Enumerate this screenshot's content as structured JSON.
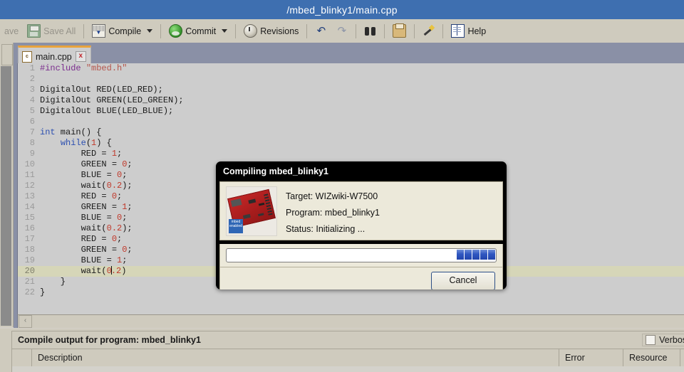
{
  "titlebar": {
    "title": "/mbed_blinky1/main.cpp"
  },
  "toolbar": {
    "items": [
      {
        "label": "ave",
        "icon": "save-icon",
        "disabled": true,
        "caret": false
      },
      {
        "label": "Save All",
        "icon": "save-all-icon",
        "disabled": true,
        "caret": false
      },
      {
        "label": "Compile",
        "icon": "compile-icon",
        "disabled": false,
        "caret": true
      },
      {
        "label": "Commit",
        "icon": "commit-icon",
        "disabled": false,
        "caret": true
      },
      {
        "label": "Revisions",
        "icon": "revisions-clock-icon",
        "disabled": false,
        "caret": false
      },
      {
        "label": "",
        "icon": "undo-icon",
        "disabled": false,
        "caret": false
      },
      {
        "label": "",
        "icon": "redo-icon",
        "disabled": true,
        "caret": false
      },
      {
        "label": "",
        "icon": "find-binoculars-icon",
        "disabled": false,
        "caret": false
      },
      {
        "label": "",
        "icon": "print-icon",
        "disabled": false,
        "caret": false
      },
      {
        "label": "",
        "icon": "format-wand-icon",
        "disabled": false,
        "caret": false
      },
      {
        "label": "Help",
        "icon": "help-book-icon",
        "disabled": false,
        "caret": false
      }
    ]
  },
  "editor": {
    "tab": {
      "filename": "main.cpp",
      "file_icon": "c-file-icon",
      "close_label": "x"
    },
    "active_line": 20,
    "scrollbar_left_arrow": "‹",
    "lines": [
      {
        "n": 1,
        "segments": [
          {
            "t": "#include ",
            "c": "k-pre"
          },
          {
            "t": "\"mbed.h\"",
            "c": "k-str"
          }
        ]
      },
      {
        "n": 2,
        "segments": []
      },
      {
        "n": 3,
        "segments": [
          {
            "t": "DigitalOut RED(LED_RED);",
            "c": ""
          }
        ]
      },
      {
        "n": 4,
        "segments": [
          {
            "t": "DigitalOut GREEN(LED_GREEN);",
            "c": ""
          }
        ]
      },
      {
        "n": 5,
        "segments": [
          {
            "t": "DigitalOut BLUE(LED_BLUE);",
            "c": ""
          }
        ]
      },
      {
        "n": 6,
        "segments": []
      },
      {
        "n": 7,
        "segments": [
          {
            "t": "int",
            "c": "k-key"
          },
          {
            "t": " main() {",
            "c": ""
          }
        ]
      },
      {
        "n": 8,
        "segments": [
          {
            "t": "    ",
            "c": ""
          },
          {
            "t": "while",
            "c": "k-key"
          },
          {
            "t": "(",
            "c": ""
          },
          {
            "t": "1",
            "c": "k-num"
          },
          {
            "t": ") {",
            "c": ""
          }
        ]
      },
      {
        "n": 9,
        "segments": [
          {
            "t": "        RED = ",
            "c": ""
          },
          {
            "t": "1",
            "c": "k-num"
          },
          {
            "t": ";",
            "c": ""
          }
        ]
      },
      {
        "n": 10,
        "segments": [
          {
            "t": "        GREEN = ",
            "c": ""
          },
          {
            "t": "0",
            "c": "k-num"
          },
          {
            "t": ";",
            "c": ""
          }
        ]
      },
      {
        "n": 11,
        "segments": [
          {
            "t": "        BLUE = ",
            "c": ""
          },
          {
            "t": "0",
            "c": "k-num"
          },
          {
            "t": ";",
            "c": ""
          }
        ]
      },
      {
        "n": 12,
        "segments": [
          {
            "t": "        wait(",
            "c": ""
          },
          {
            "t": "0.2",
            "c": "k-num"
          },
          {
            "t": ");",
            "c": ""
          }
        ]
      },
      {
        "n": 13,
        "segments": [
          {
            "t": "        RED = ",
            "c": ""
          },
          {
            "t": "0",
            "c": "k-num"
          },
          {
            "t": ";",
            "c": ""
          }
        ]
      },
      {
        "n": 14,
        "segments": [
          {
            "t": "        GREEN = ",
            "c": ""
          },
          {
            "t": "1",
            "c": "k-num"
          },
          {
            "t": ";",
            "c": ""
          }
        ]
      },
      {
        "n": 15,
        "segments": [
          {
            "t": "        BLUE = ",
            "c": ""
          },
          {
            "t": "0",
            "c": "k-num"
          },
          {
            "t": ";",
            "c": ""
          }
        ]
      },
      {
        "n": 16,
        "segments": [
          {
            "t": "        wait(",
            "c": ""
          },
          {
            "t": "0.2",
            "c": "k-num"
          },
          {
            "t": ");",
            "c": ""
          }
        ]
      },
      {
        "n": 17,
        "segments": [
          {
            "t": "        RED = ",
            "c": ""
          },
          {
            "t": "0",
            "c": "k-num"
          },
          {
            "t": ";",
            "c": ""
          }
        ]
      },
      {
        "n": 18,
        "segments": [
          {
            "t": "        GREEN = ",
            "c": ""
          },
          {
            "t": "0",
            "c": "k-num"
          },
          {
            "t": ";",
            "c": ""
          }
        ]
      },
      {
        "n": 19,
        "segments": [
          {
            "t": "        BLUE = ",
            "c": ""
          },
          {
            "t": "1",
            "c": "k-num"
          },
          {
            "t": ";",
            "c": ""
          }
        ]
      },
      {
        "n": 20,
        "segments": [
          {
            "t": "        wait(",
            "c": ""
          },
          {
            "t": "0",
            "c": "k-num"
          },
          {
            "t": "|",
            "c": "caret"
          },
          {
            "t": ".2",
            "c": "k-num"
          },
          {
            "t": ")",
            "c": ""
          }
        ]
      },
      {
        "n": 21,
        "segments": [
          {
            "t": "    }",
            "c": ""
          }
        ]
      },
      {
        "n": 22,
        "segments": [
          {
            "t": "}",
            "c": ""
          }
        ]
      }
    ]
  },
  "dialog": {
    "title": "Compiling mbed_blinky1",
    "image_name": "wizwiki-w7500-board-photo",
    "badge_text": "mbed enabled",
    "target_row": "Target: WIZwiki-W7500",
    "program_row": "Program: mbed_blinky1",
    "status_row": "Status: Initializing ...",
    "progress": {
      "style": "marquee",
      "blocks": 5,
      "color": "#2346ad"
    },
    "cancel_label": "Cancel"
  },
  "output_panel": {
    "header": "Compile output for program: mbed_blinky1",
    "verbose_label": "Verbose",
    "verbose_checked": false,
    "columns": [
      "",
      "Description",
      "Error Number",
      "Resource"
    ],
    "rows": []
  },
  "colors": {
    "titlebar_bg": "#3e6fb0",
    "toolbar_bg": "#cfcbbe",
    "tab_accent": "#e8a33d",
    "editor_bg": "#cdcdcd",
    "active_line_bg": "#d6d6b8",
    "dialog_header_bg": "#000000",
    "dialog_body_bg": "#ece9da"
  }
}
